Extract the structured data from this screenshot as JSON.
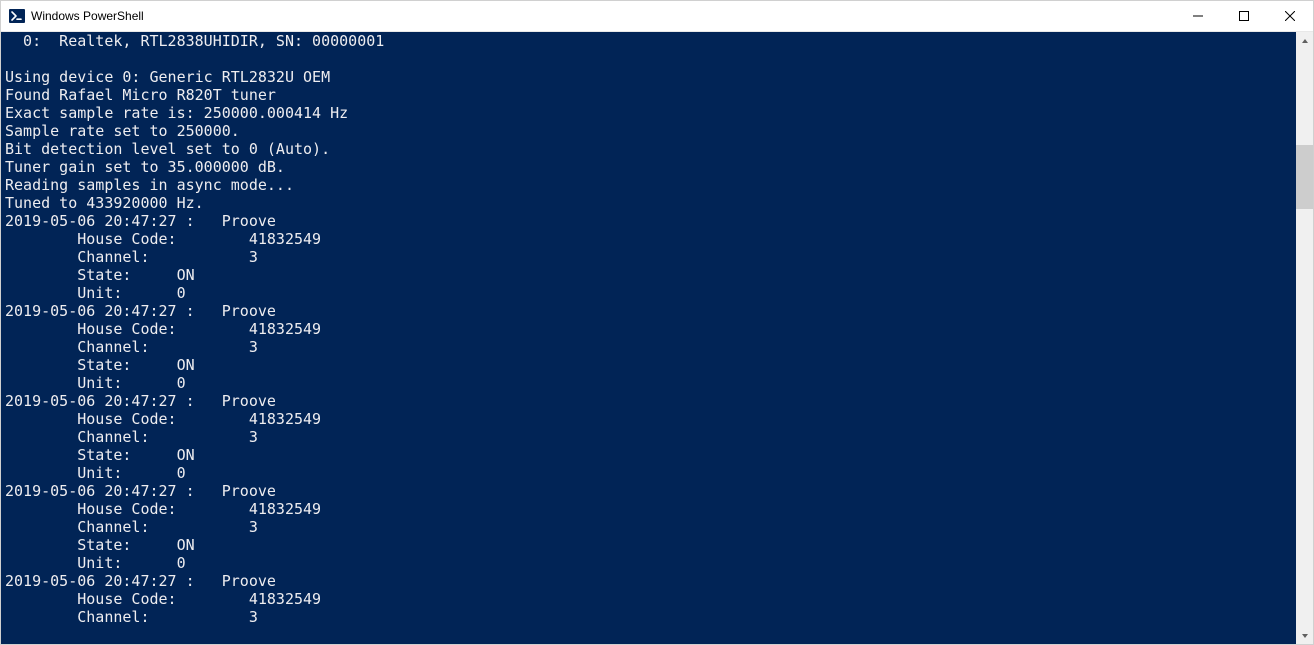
{
  "window": {
    "title": "Windows PowerShell"
  },
  "terminal": {
    "header_lines": [
      "  0:  Realtek, RTL2838UHIDIR, SN: 00000001",
      "",
      "Using device 0: Generic RTL2832U OEM",
      "Found Rafael Micro R820T tuner",
      "Exact sample rate is: 250000.000414 Hz",
      "Sample rate set to 250000.",
      "Bit detection level set to 0 (Auto).",
      "Tuner gain set to 35.000000 dB.",
      "Reading samples in async mode...",
      "Tuned to 433920000 Hz."
    ],
    "events": [
      {
        "timestamp": "2019-05-06 20:47:27",
        "protocol": "Proove",
        "house_code": "41832549",
        "channel": "3",
        "state": "ON",
        "unit": "0",
        "truncated": false
      },
      {
        "timestamp": "2019-05-06 20:47:27",
        "protocol": "Proove",
        "house_code": "41832549",
        "channel": "3",
        "state": "ON",
        "unit": "0",
        "truncated": false
      },
      {
        "timestamp": "2019-05-06 20:47:27",
        "protocol": "Proove",
        "house_code": "41832549",
        "channel": "3",
        "state": "ON",
        "unit": "0",
        "truncated": false
      },
      {
        "timestamp": "2019-05-06 20:47:27",
        "protocol": "Proove",
        "house_code": "41832549",
        "channel": "3",
        "state": "ON",
        "unit": "0",
        "truncated": false
      },
      {
        "timestamp": "2019-05-06 20:47:27",
        "protocol": "Proove",
        "house_code": "41832549",
        "channel": "3",
        "truncated": true
      }
    ],
    "labels": {
      "house_code": "House Code:",
      "channel": "Channel:",
      "state": "State:",
      "unit": "Unit:"
    }
  }
}
